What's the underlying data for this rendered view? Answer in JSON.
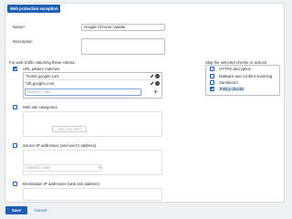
{
  "header": {
    "title": "Web protection exception"
  },
  "form": {
    "name_label": "Name",
    "name_required": "*",
    "name_value": "Google Chrome Update",
    "description_label": "Description",
    "criteria_label": "For web traffic matching these criteria:",
    "url_patterns": {
      "label": "URL pattern matches",
      "checked": true,
      "items": [
        "^tools\\.google\\.com",
        "^dl\\.google\\.com"
      ],
      "add_placeholder": "Search / Add"
    },
    "web_categories": {
      "label": "Web site categories",
      "checked": false,
      "add_button": "Add new item"
    },
    "source_ip": {
      "label": "Source IP addresses (and user's address)",
      "checked": false,
      "add_placeholder": "Search / Add"
    },
    "destination_ip": {
      "label": "Destination IP addresses (web site address)",
      "checked": false
    }
  },
  "skip": {
    "label": "Skip the selected checks or actions:",
    "items": [
      {
        "label": "HTTPS decryption",
        "checked": false
      },
      {
        "label": "Malware and content scanning",
        "checked": false
      },
      {
        "label": "Sandstorm",
        "checked": false
      },
      {
        "label": "Policy checks",
        "checked": true
      }
    ]
  },
  "footer": {
    "save": "Save",
    "cancel": "Cancel"
  },
  "colors": {
    "accent": "#1f5fb3",
    "border": "#b9c0c8",
    "background": "#eef1f4"
  }
}
